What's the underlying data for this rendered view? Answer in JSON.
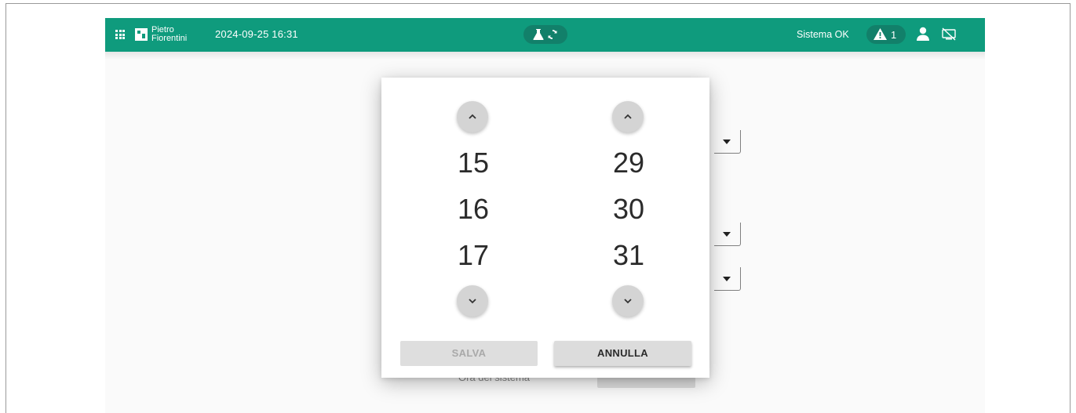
{
  "header": {
    "logo_line1": "Pietro",
    "logo_line2": "Fiorentini",
    "datetime": "2024-09-25 16:31",
    "status_text": "Sistema OK",
    "alarm_count": "1"
  },
  "background": {
    "label": "Ora del sistema"
  },
  "time_picker": {
    "hours": [
      "15",
      "16",
      "17"
    ],
    "minutes": [
      "29",
      "30",
      "31"
    ],
    "save_label": "SALVA",
    "cancel_label": "ANNULLA",
    "save_enabled": false
  },
  "colors": {
    "brand": "#0f9b7d",
    "brand_dark": "#12806a"
  },
  "icons": [
    "apps-grid-icon",
    "flask-icon",
    "sync-icon",
    "warning-icon",
    "user-icon",
    "network-off-icon",
    "chevron-up-icon",
    "chevron-down-icon"
  ]
}
